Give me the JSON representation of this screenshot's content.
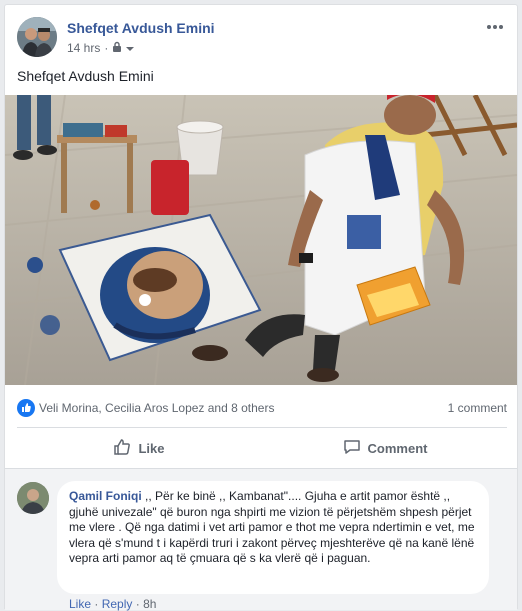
{
  "post": {
    "author": "Shefqet Avdush Emini",
    "timestamp": "14 hrs",
    "privacy_icon": "lock-icon",
    "caption": "Shefqet Avdush Emini",
    "media": {
      "type": "video-frame",
      "description_icon": "painting-scene"
    }
  },
  "stats": {
    "reactions_text": "Veli Morina, Cecilia Aros Lopez and 8 others",
    "comment_count": "1 comment",
    "reaction_icon": "like-icon"
  },
  "actions": {
    "like_label": "Like",
    "comment_label": "Comment"
  },
  "comment": {
    "author": "Qamil Foniqi",
    "text": ",, Për ke binë ,, Kambanat\".... Gjuha e artit pamor është ,, gjuhë univezale\" që buron nga shpirti me vizion të përjetshëm shpesh përjet me vlere . Që nga datimi i vet arti pamor e thot me vepra ndertimin e vet, me vlera që s'mund t i kapërdi truri i zakont përveç mjeshterëve që na kanë lënë vepra arti pamor aq të çmuara që s ka vlerë që i paguan.",
    "like_label": "Like",
    "reply_label": "Reply",
    "separator": "·",
    "time": "8h"
  },
  "colors": {
    "link_blue": "#385898",
    "like_blue": "#4267b2",
    "muted": "#606770",
    "background": "#e9ebee"
  }
}
